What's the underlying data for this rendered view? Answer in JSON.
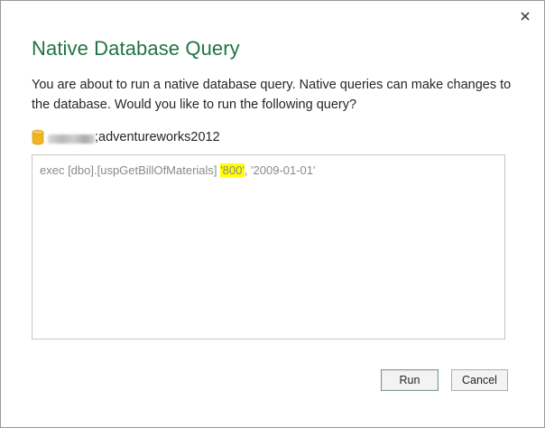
{
  "dialog": {
    "title": "Native Database Query",
    "message": "You are about to run a native database query. Native queries can make changes to the database. Would you like to run the following query?",
    "close_icon": "close-icon",
    "source": {
      "icon": "database-icon",
      "separator": ";",
      "database": "adventureworks2012"
    },
    "query": {
      "part1": "exec [dbo].[uspGetBillOfMaterials] ",
      "highlight": "'800'",
      "part2": ", '2009-01-01'"
    },
    "buttons": {
      "run_label": "Run",
      "cancel_label": "Cancel"
    },
    "colors": {
      "title": "#217346",
      "highlight": "#ffff00",
      "db_icon": "#f0b323"
    }
  }
}
